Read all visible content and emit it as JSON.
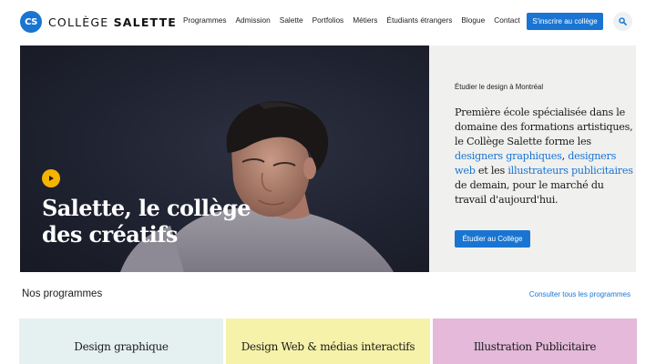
{
  "brand": {
    "badge": "CS",
    "name_light": "COLLÈGE",
    "name_bold": "SALETTE",
    "accent": "#1a75d2"
  },
  "nav": {
    "items": [
      "Programmes",
      "Admission",
      "Salette",
      "Portfolios",
      "Métiers",
      "Étudiants étrangers",
      "Blogue",
      "Contact"
    ],
    "cta": "S'inscrire au collège",
    "search_icon": "search-icon"
  },
  "hero": {
    "title": "Salette, le collège des créatifs",
    "play_icon": "play-icon",
    "eyebrow": "Étudier le design à Montréal",
    "desc_1": "Première école spécialisée dans le domaine des formations artistiques, le Collège Salette forme les ",
    "link_1": "designers graphiques",
    "desc_2": ", ",
    "link_2": "designers web",
    "desc_3": " et les ",
    "link_3": "illustrateurs publicitaires",
    "desc_4": " de demain, pour le marché du travail d'aujourd'hui.",
    "button": "Étudier au Collège"
  },
  "programs": {
    "title": "Nos programmes",
    "link": "Consulter tous les programmes",
    "cards": [
      {
        "label": "Design graphique",
        "color": "#e5f1f0"
      },
      {
        "label": "Design Web & médias interactifs",
        "color": "#f6f2a9"
      },
      {
        "label": "Illustration Publicitaire",
        "color": "#e4b9d9"
      }
    ]
  }
}
